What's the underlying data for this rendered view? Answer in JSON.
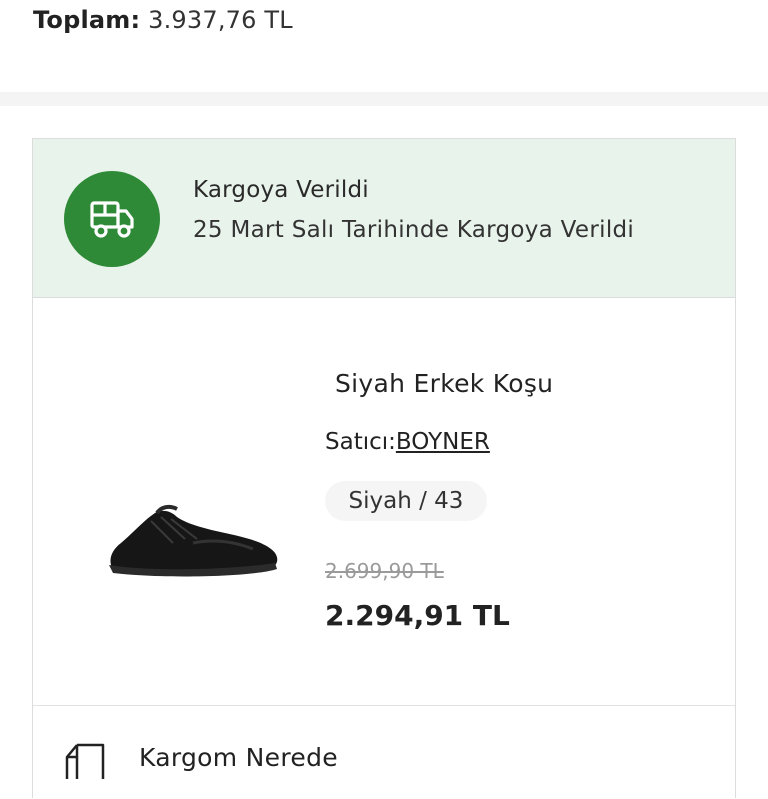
{
  "summary": {
    "total_label": "Toplam:",
    "total_value": "3.937,76 TL"
  },
  "shipment": {
    "status_title": "Kargoya Verildi",
    "status_detail": "25 Mart Salı Tarihinde Kargoya Verildi",
    "status_color": "#2e8a37",
    "status_bg": "#e8f3eb",
    "icon": "truck-icon"
  },
  "product": {
    "name": "Siyah Erkek Koşu",
    "seller_label": "Satıcı:",
    "seller_name": "BOYNER",
    "variant": "Siyah / 43",
    "old_price": "2.699,90 TL",
    "price": "2.294,91 TL",
    "image": "black-running-shoe"
  },
  "actions": {
    "where_label": "Kargom Nerede",
    "where_icon": "package-icon"
  }
}
